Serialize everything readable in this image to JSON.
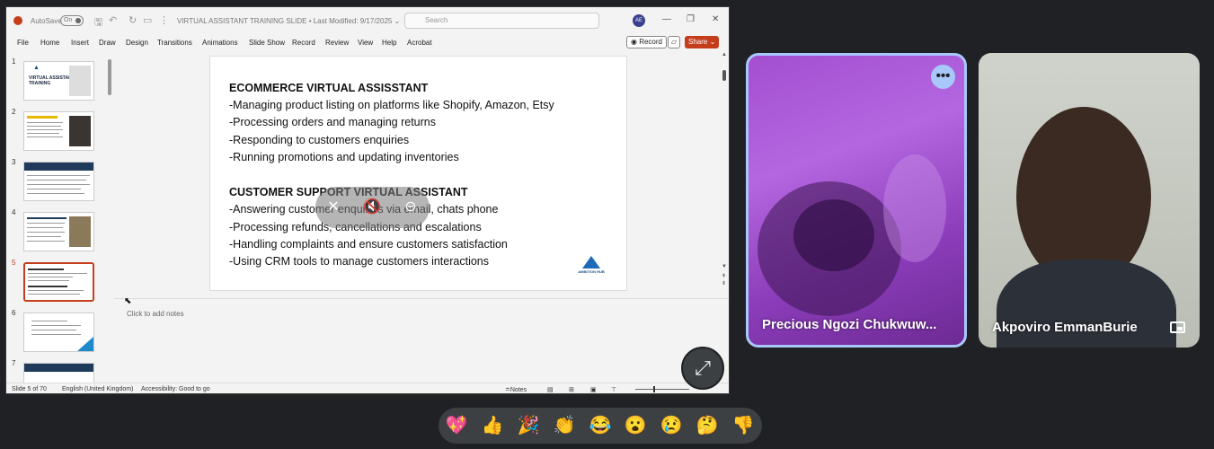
{
  "ppt": {
    "autosave_label": "AutoSave",
    "autosave_state": "On",
    "doc_title": "VIRTUAL  ASSISTANT TRAINING SLIDE  •  Last Modified: 9/17/2025  ⌄",
    "search_placeholder": "Search",
    "user_initials": "AE",
    "menu": [
      "File",
      "Home",
      "Insert",
      "Draw",
      "Design",
      "Transitions",
      "Animations",
      "Slide Show",
      "Record",
      "Review",
      "View",
      "Help",
      "Acrobat"
    ],
    "record_label": "Record",
    "share_label": "Share ⌄",
    "thumbnails": [
      {
        "num": "1",
        "title": "VIRTUAL ASSISTANT TRAINING"
      },
      {
        "num": "2",
        "title": ""
      },
      {
        "num": "3",
        "title": "WHO IS A VIRTUAL ASSISTANT"
      },
      {
        "num": "4",
        "title": ""
      },
      {
        "num": "5",
        "title": ""
      },
      {
        "num": "6",
        "title": ""
      },
      {
        "num": "7",
        "title": ""
      }
    ],
    "slide": {
      "lines": [
        "ECOMMERCE VIRTUAL ASSISSTANT",
        "-Managing product listing on platforms like Shopify, Amazon, Etsy",
        "-Processing orders and managing returns",
        "-Responding to customers enquiries",
        "-Running promotions and updating inventories",
        "CUSTOMER SUPPORT VIRTUAL ASSISTANT",
        "-Answering customer enquiries via email, chats phone",
        "-Processing refunds, cancellations and escalations",
        "-Handling complaints and ensure customers satisfaction",
        "-Using CRM tools to manage customers interactions"
      ],
      "logo_text": "AMBITION HUB"
    },
    "notes_placeholder": "Click to add notes",
    "status": {
      "slide_count": "Slide 5 of 70",
      "language": "English (United Kingdom)",
      "accessibility": "Accessibility: Good to go",
      "notes_label": "≐Notes"
    }
  },
  "participants": [
    {
      "name": "Precious Ngozi Chukwuw..."
    },
    {
      "name": "Akpoviro EmmanBurie"
    }
  ],
  "reactions": [
    "💖",
    "👍",
    "🎉",
    "👏",
    "😂",
    "😮",
    "😢",
    "🤔",
    "👎"
  ],
  "icons": {
    "expand": "⤢",
    "more": "•••"
  }
}
